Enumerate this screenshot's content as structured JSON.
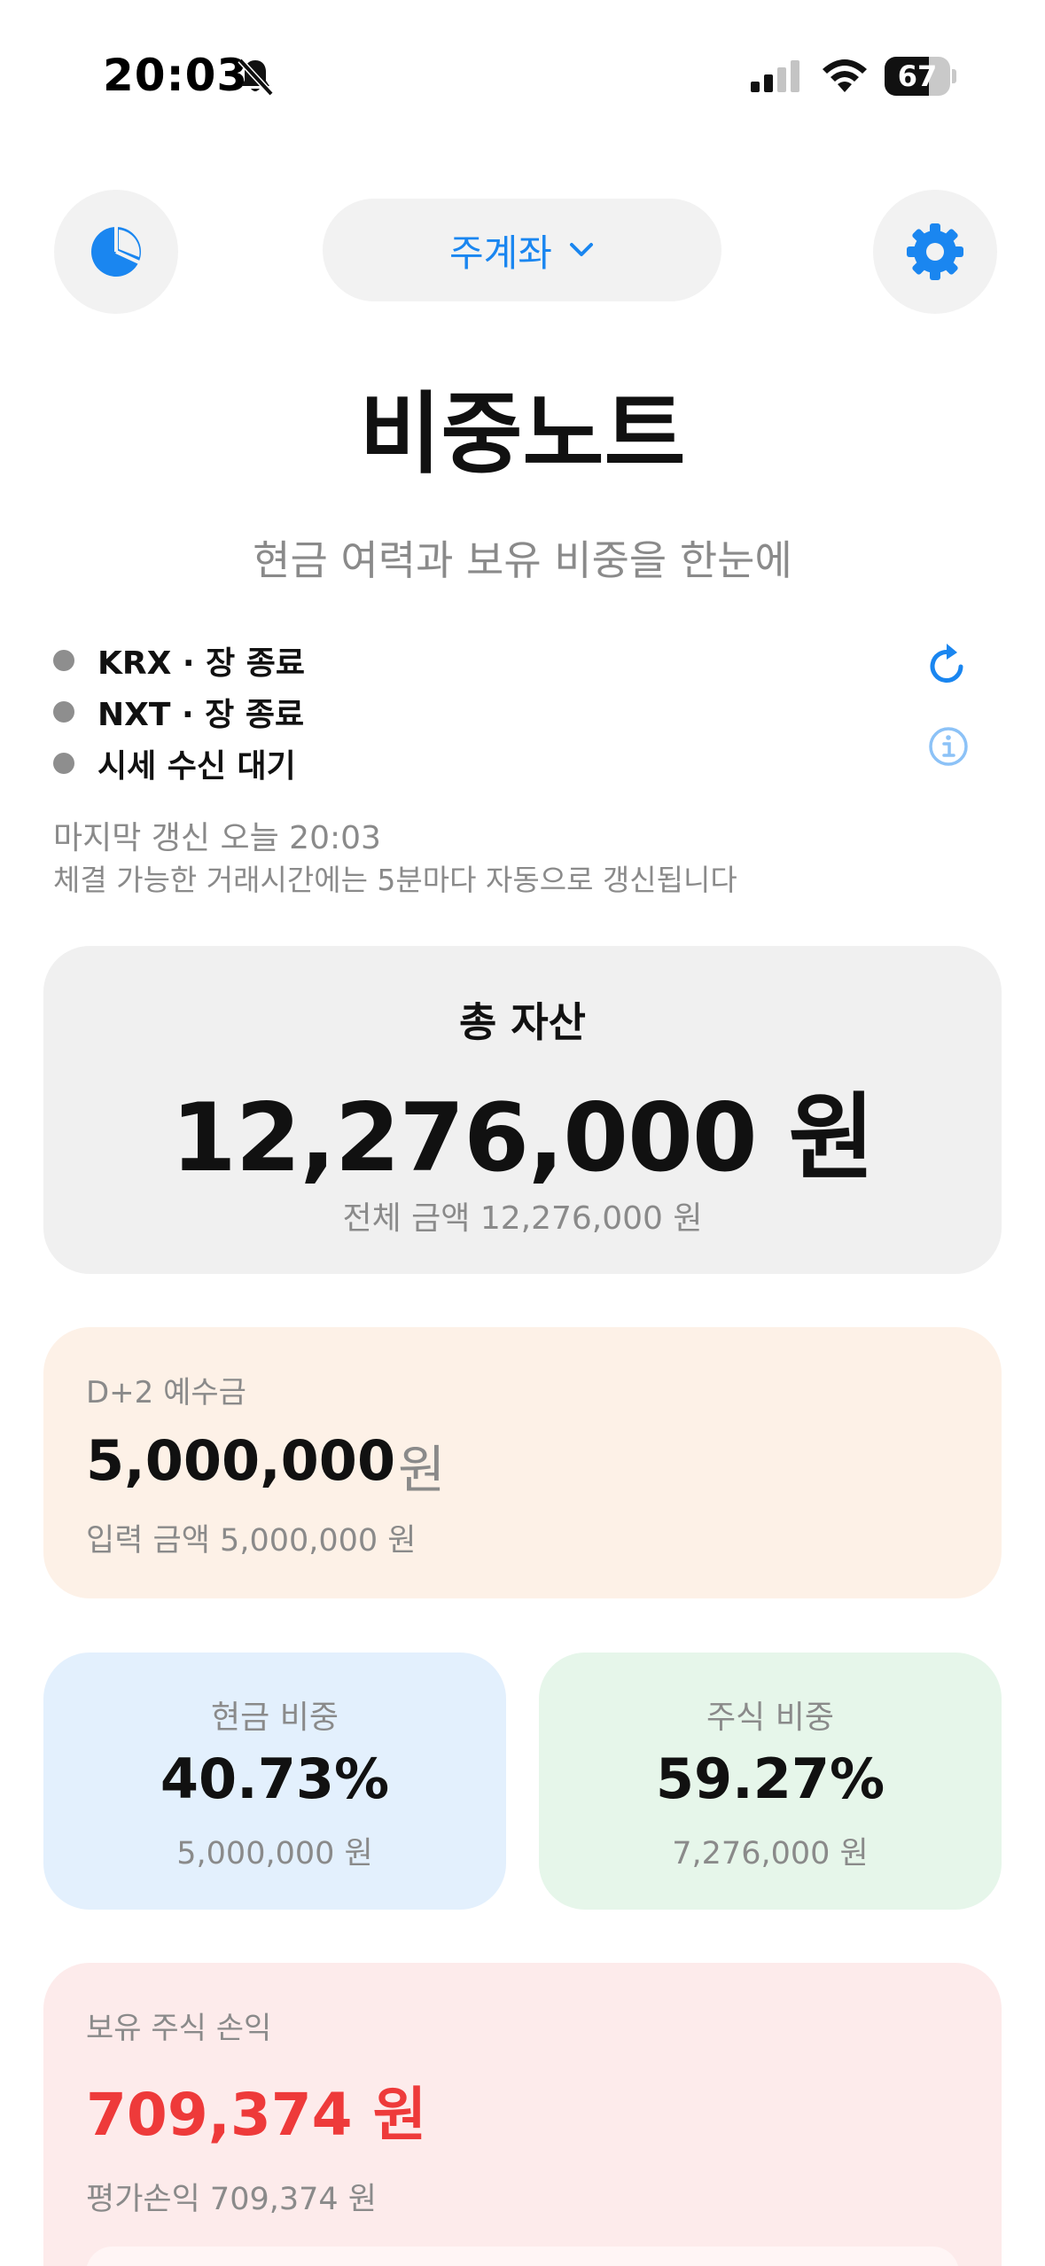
{
  "status_bar": {
    "time": "20:03",
    "battery_level": "67",
    "icons": [
      "bell-slash-icon",
      "signal-icon",
      "wifi-icon",
      "battery-icon"
    ]
  },
  "nav": {
    "left_icon": "pie-chart-icon",
    "account_label": "주계좌",
    "account_icon": "chevron-down-icon",
    "right_icon": "gear-icon",
    "accent_color": "#1a86f0"
  },
  "header": {
    "title": "비중노트",
    "subtitle": "현금 여력과 보유 비중을 한눈에"
  },
  "market": {
    "items": [
      {
        "text": "KRX · 장 종료"
      },
      {
        "text": "NXT · 장 종료"
      },
      {
        "text": "시세 수신 대기"
      }
    ],
    "last_update": "마지막 갱신 오늘 20:03",
    "auto_note": "체결 가능한 거래시간에는 5분마다 자동으로 갱신됩니다"
  },
  "total": {
    "label": "총 자산",
    "value": "12,276,000 원",
    "sub": "전체 금액 12,276,000 원"
  },
  "deposit": {
    "label": "D+2 예수금",
    "value": "5,000,000",
    "unit": "원",
    "sub": "입력 금액 5,000,000 원"
  },
  "cash_ratio": {
    "label": "현금 비중",
    "value": "40.73%",
    "amount": "5,000,000 원"
  },
  "stock_ratio": {
    "label": "주식 비중",
    "value": "59.27%",
    "amount": "7,276,000 원"
  },
  "profit_loss": {
    "label": "보유 주식 손익",
    "value": "709,374 원",
    "sub": "평가손익 709,374 원",
    "color": "#ee3a3a"
  }
}
